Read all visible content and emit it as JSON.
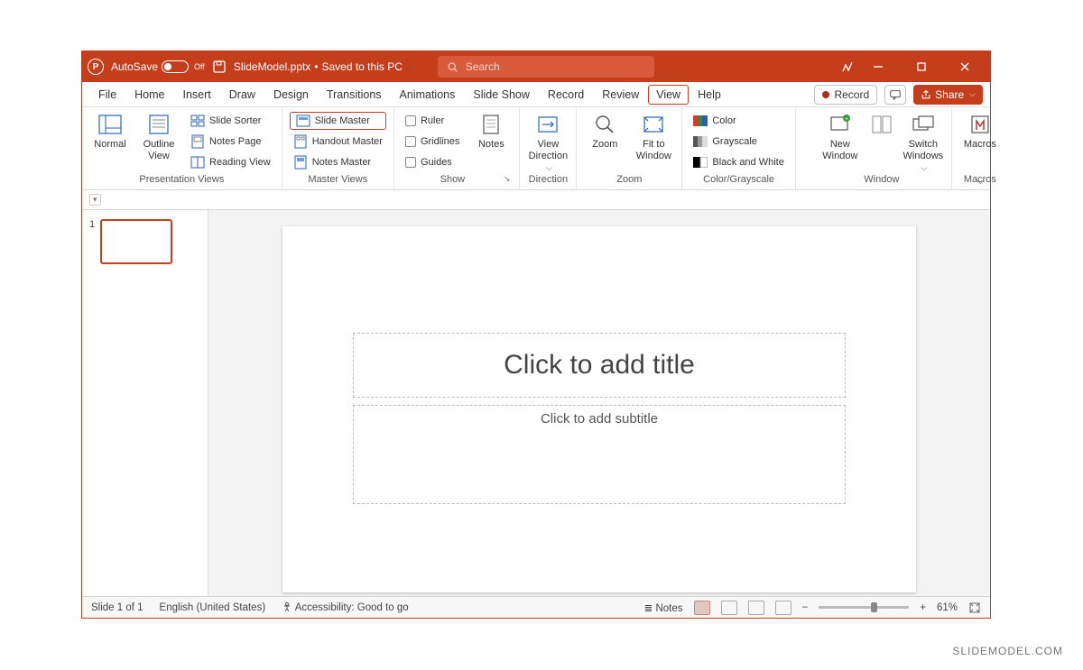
{
  "titlebar": {
    "autosave_label": "AutoSave",
    "autosave_state": "Off",
    "filename": "SlideModel.pptx",
    "save_state": "Saved to this PC",
    "search_placeholder": "Search"
  },
  "tabs": {
    "file": "File",
    "home": "Home",
    "insert": "Insert",
    "draw": "Draw",
    "design": "Design",
    "transitions": "Transitions",
    "animations": "Animations",
    "slideshow": "Slide Show",
    "record": "Record",
    "review": "Review",
    "view": "View",
    "help": "Help",
    "record_btn": "Record",
    "share_btn": "Share"
  },
  "ribbon": {
    "presentation_views": {
      "label": "Presentation Views",
      "normal": "Normal",
      "outline": "Outline\nView",
      "slide_sorter": "Slide Sorter",
      "notes_page": "Notes Page",
      "reading_view": "Reading View"
    },
    "master_views": {
      "label": "Master Views",
      "slide_master": "Slide Master",
      "handout_master": "Handout Master",
      "notes_master": "Notes Master"
    },
    "show": {
      "label": "Show",
      "ruler": "Ruler",
      "gridlines": "Gridlines",
      "guides": "Guides"
    },
    "notes": "Notes",
    "direction": {
      "label": "Direction",
      "view_direction": "View\nDirection"
    },
    "zoom": {
      "label": "Zoom",
      "zoom": "Zoom",
      "fit": "Fit to\nWindow"
    },
    "color": {
      "label": "Color/Grayscale",
      "color": "Color",
      "grayscale": "Grayscale",
      "bw": "Black and White"
    },
    "window": {
      "label": "Window",
      "new": "New\nWindow",
      "switch": "Switch\nWindows"
    },
    "macros": {
      "label": "Macros",
      "macros": "Macros"
    }
  },
  "slide": {
    "number": "1",
    "title_placeholder": "Click to add title",
    "subtitle_placeholder": "Click to add subtitle"
  },
  "status": {
    "slide_count": "Slide 1 of 1",
    "language": "English (United States)",
    "accessibility": "Accessibility: Good to go",
    "notes": "Notes",
    "zoom": "61%"
  },
  "watermark": "SLIDEMODEL.COM"
}
